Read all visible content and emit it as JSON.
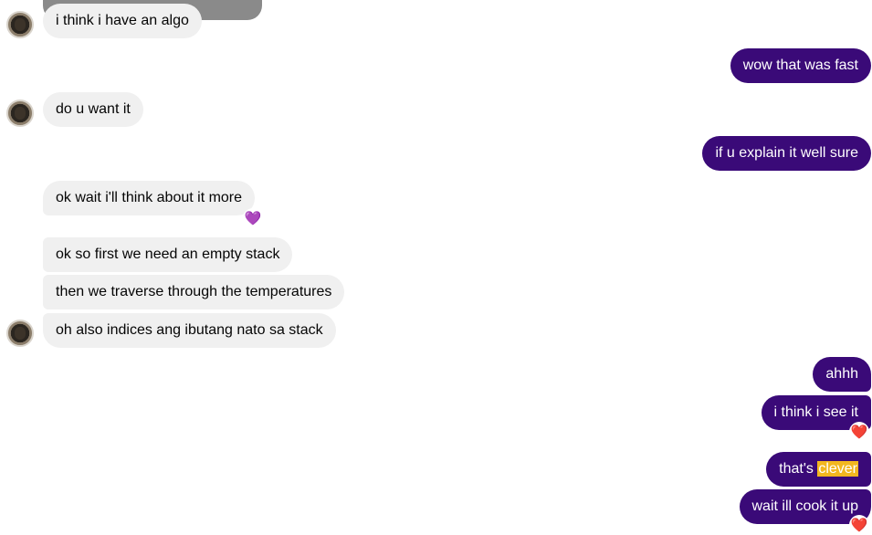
{
  "messages": {
    "m1": "i think i have an algo",
    "m2": "wow that was fast",
    "m3": "do u want it",
    "m4": "if u explain it well sure",
    "m5": "ok wait i'll think about it more",
    "m6": "ok so first we need an empty stack",
    "m7": "then we traverse through the temperatures",
    "m8": "oh also indices ang ibutang nato sa stack",
    "m9": "ahhh",
    "m10": "i think i see it",
    "m11_prefix": "that's ",
    "m11_highlight": "clever",
    "m12": "wait ill cook it up"
  },
  "reactions": {
    "purple_heart": "💜",
    "heart_a": "❤️",
    "heart_b": "❤️"
  },
  "colors": {
    "incoming_bubble": "#f0f0f0",
    "outgoing_bubble": "#3a0a78",
    "highlight": "#f2b71f"
  },
  "icons": {
    "avatar": "contact-avatar-icon",
    "purple_heart": "purple-heart-reaction-icon",
    "heart": "red-heart-reaction-icon"
  }
}
